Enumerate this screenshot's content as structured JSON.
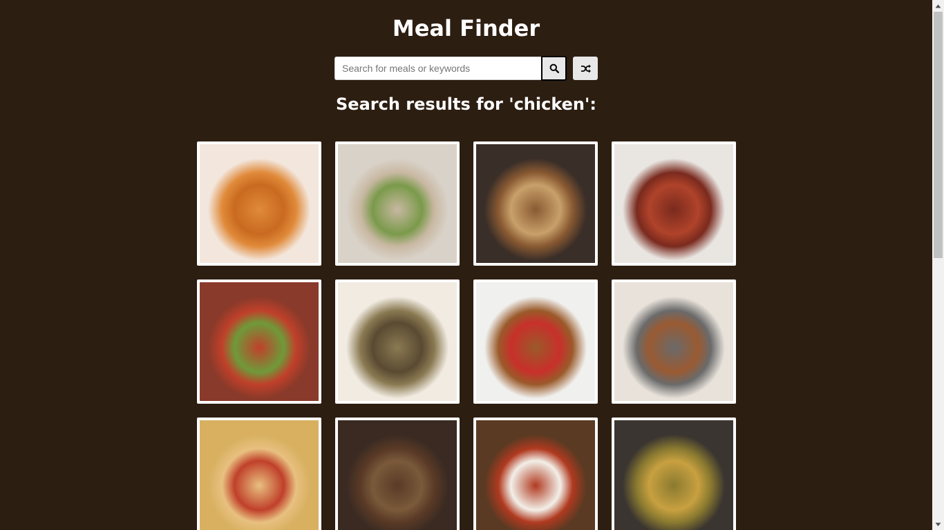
{
  "header": {
    "title": "Meal Finder"
  },
  "search": {
    "placeholder": "Search for meals or keywords",
    "value": "",
    "search_icon": "search-icon",
    "random_icon": "shuffle-icon"
  },
  "results": {
    "heading": "Search results for 'chicken':",
    "meals": [
      {
        "name": "meal-1",
        "colors": [
          "#f3e6dc",
          "#e08a3a",
          "#c96a20",
          "#7da04a"
        ]
      },
      {
        "name": "meal-2",
        "colors": [
          "#d9d2c8",
          "#c8b8a2",
          "#7a9a4a",
          "#1e4c9a"
        ]
      },
      {
        "name": "meal-3",
        "colors": [
          "#3a2e28",
          "#8a5a32",
          "#c8a06a",
          "#8fcf5a"
        ]
      },
      {
        "name": "meal-4",
        "colors": [
          "#e9e6e2",
          "#7a2a1e",
          "#b0432a",
          "#223a6a"
        ]
      },
      {
        "name": "meal-5",
        "colors": [
          "#8a3a2a",
          "#c0402a",
          "#6f9a3a",
          "#f2e0c0"
        ]
      },
      {
        "name": "meal-6",
        "colors": [
          "#f1ebe2",
          "#8a7a52",
          "#5a4a32",
          "#b6a27a"
        ]
      },
      {
        "name": "meal-7",
        "colors": [
          "#f0f0ee",
          "#9a5a2a",
          "#c8302a",
          "#3a7a3a"
        ]
      },
      {
        "name": "meal-8",
        "colors": [
          "#e8e2da",
          "#6a6a6a",
          "#9a5a32",
          "#e0a030"
        ]
      },
      {
        "name": "meal-9",
        "colors": [
          "#d8b060",
          "#e8c080",
          "#c0402a",
          "#2a5aa0"
        ]
      },
      {
        "name": "meal-10",
        "colors": [
          "#3a2a22",
          "#5a3a26",
          "#7a5a3a",
          "#2a1e18"
        ]
      },
      {
        "name": "meal-11",
        "colors": [
          "#5a3a22",
          "#b03a20",
          "#f2efe8",
          "#2a3a6a"
        ]
      },
      {
        "name": "meal-12",
        "colors": [
          "#3a3530",
          "#8a7a30",
          "#c8a040",
          "#2a2a30"
        ]
      }
    ]
  }
}
